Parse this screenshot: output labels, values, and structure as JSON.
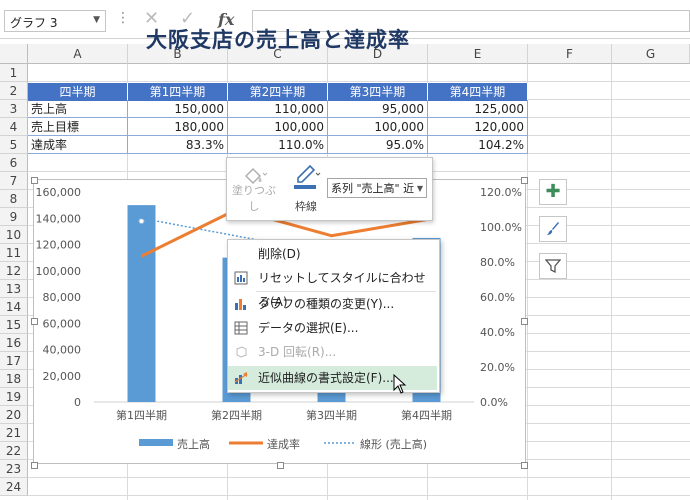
{
  "formula_bar": {
    "name_box": "グラフ 3",
    "cancel_icon": "✕",
    "enter_icon": "✓",
    "fx_label": "fx",
    "formula": ""
  },
  "columns": [
    "A",
    "B",
    "C",
    "D",
    "E",
    "F",
    "G"
  ],
  "rows": [
    "1",
    "2",
    "3",
    "4",
    "5",
    "6",
    "7",
    "8",
    "9",
    "10",
    "11",
    "12",
    "13",
    "14",
    "15",
    "16",
    "17",
    "18",
    "19",
    "20",
    "21",
    "22",
    "23",
    "24"
  ],
  "sheet": {
    "title": "大阪支店の売上高と達成率",
    "header": [
      "四半期",
      "第1四半期",
      "第2四半期",
      "第3四半期",
      "第4四半期"
    ],
    "rows": [
      {
        "label": "売上高",
        "values": [
          "150,000",
          "110,000",
          "95,000",
          "125,000"
        ]
      },
      {
        "label": "売上目標",
        "values": [
          "180,000",
          "100,000",
          "100,000",
          "120,000"
        ]
      },
      {
        "label": "達成率",
        "values": [
          "83.3%",
          "110.0%",
          "95.0%",
          "104.2%"
        ]
      }
    ]
  },
  "chart_data": {
    "type": "bar",
    "categories": [
      "第1四半期",
      "第2四半期",
      "第3四半期",
      "第4四半期"
    ],
    "series": [
      {
        "name": "売上高",
        "type": "bar",
        "axis": "left",
        "values": [
          150000,
          110000,
          95000,
          125000
        ],
        "color": "#5b9bd5"
      },
      {
        "name": "達成率",
        "type": "line",
        "axis": "right",
        "values": [
          0.833,
          1.1,
          0.95,
          1.042
        ],
        "color": "#ed7d31"
      },
      {
        "name": "線形 (売上高)",
        "type": "trendline",
        "axis": "left",
        "values": [
          140000,
          126500,
          113000,
          99500
        ],
        "color": "#5b9bd5"
      }
    ],
    "left_ticks": [
      "160,000",
      "140,000",
      "120,000",
      "100,000",
      "80,000",
      "60,000",
      "40,000",
      "20,000",
      "0"
    ],
    "right_ticks": [
      "120.0%",
      "100.0%",
      "80.0%",
      "60.0%",
      "40.0%",
      "20.0%",
      "0.0%"
    ],
    "ylim_left": [
      0,
      160000
    ],
    "ylim_right": [
      0,
      1.2
    ],
    "legend": "bottom",
    "grid": false
  },
  "mini_toolbar": {
    "fill_label": "塗りつぶし",
    "outline_label": "枠線",
    "series_select": "系列 \"売上高\" 近"
  },
  "context_menu": {
    "items": [
      {
        "label": "削除(D)",
        "disabled": false,
        "icon": "none"
      },
      {
        "label": "リセットしてスタイルに合わせる(A)",
        "disabled": false,
        "icon": "reset-style-icon"
      },
      {
        "label": "グラフの種類の変更(Y)...",
        "disabled": false,
        "icon": "chart-type-icon"
      },
      {
        "label": "データの選択(E)...",
        "disabled": false,
        "icon": "select-data-icon"
      },
      {
        "label": "3-D 回転(R)...",
        "disabled": true,
        "icon": "3d-rotation-icon"
      },
      {
        "label": "近似曲線の書式設定(F)...",
        "disabled": false,
        "icon": "format-trendline-icon"
      }
    ]
  },
  "colors": {
    "header_blue": "#4472c4",
    "title_navy": "#1f3864",
    "bar_blue": "#5b9bd5",
    "line_orange": "#ed7d31",
    "plus_green": "#3c8d5a",
    "highlight": "#d5ebdc"
  }
}
